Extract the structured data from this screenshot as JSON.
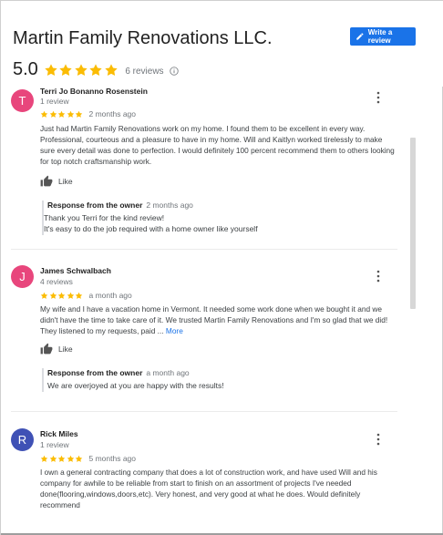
{
  "header": {
    "business_name": "Martin Family Renovations LLC.",
    "write_review_label": "Write a review",
    "rating": "5.0",
    "stars": 5,
    "review_count": "6 reviews",
    "accent_color": "#1a73e8",
    "star_color": "#fbbc04"
  },
  "reviews": [
    {
      "avatar_letter": "T",
      "avatar_color": "#e8467c",
      "name": "Terri Jo Bonanno Rosenstein",
      "meta": "1 review",
      "rating": 5,
      "date": "2 months ago",
      "text": "Just had Martin Family Renovations work on my home. I found them to be excellent in every way. Professional, courteous and a pleasure to have in my home. Will and Kaitlyn worked tirelessly to make sure every detail was done to perfection. I would definitely 100 percent recommend them to others looking for top notch craftsmanship work.",
      "like_label": "Like",
      "owner_label": "Response from the owner",
      "owner_date": "2 months ago",
      "owner_text_1": "Thank you Terri for the kind review!",
      "owner_text_2": "It's easy to do the job required with a home owner like yourself"
    },
    {
      "avatar_letter": "J",
      "avatar_color": "#e8467c",
      "name": "James Schwalbach",
      "meta": "4 reviews",
      "rating": 5,
      "date": "a month ago",
      "text": "My wife and I have a vacation home in Vermont. It needed some work done when we bought it and we didn't have the time to take care of it. We trusted Martin Family Renovations and I'm so glad that we did! They listened to my requests, paid ...",
      "more_label": "More",
      "like_label": "Like",
      "owner_label": "Response from the owner",
      "owner_date": "a month ago",
      "owner_text_1": "We are overjoyed at you are happy with the results!"
    },
    {
      "avatar_letter": "R",
      "avatar_color": "#3f51b5",
      "name": "Rick Miles",
      "meta": "1 review",
      "rating": 5,
      "date": "5 months ago",
      "text": "I own a general contracting company that does a lot of construction work, and have used Will and his company for awhile to be reliable from start to finish on an assortment of projects I've needed done(flooring,windows,doors,etc). Very honest, and very good at what he does. Would definitely recommend"
    }
  ]
}
